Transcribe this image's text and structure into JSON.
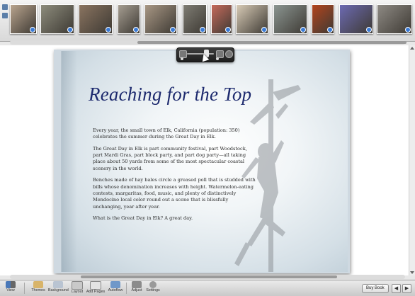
{
  "filmstrip": {
    "photos": [
      {
        "name": "group-snapshot",
        "color": "#b9a48e"
      },
      {
        "name": "outdoor-group",
        "color": "#8d8c7c"
      },
      {
        "name": "kids-pony",
        "color": "#8a7460"
      },
      {
        "name": "dog",
        "color": "#a59d91"
      },
      {
        "name": "cowboy-hat-man",
        "color": "#a89784"
      },
      {
        "name": "man-standing",
        "color": "#7e7c73"
      },
      {
        "name": "girl-watermelon",
        "color": "#c66a5b"
      },
      {
        "name": "plate-of-food",
        "color": "#d8cbb6"
      },
      {
        "name": "coastline",
        "color": "#8b9591"
      },
      {
        "name": "poppies",
        "color": "#b2441c"
      },
      {
        "name": "purple-flowers",
        "color": "#6c6ab2"
      },
      {
        "name": "peace-sign",
        "color": "#8e8a84"
      }
    ]
  },
  "page": {
    "title": "Reaching for the Top",
    "paragraphs": [
      "Every year, the small town of Elk, California (population: 350) celebrates the summer during the Great Day in Elk.",
      "The Great Day in Elk is part community festival, part Woodstock, part Mardi Gras, part block party, and part dog party—all taking place about 50 yards from some of the most spectacular coastal scenery in the world.",
      "Benches made of hay bales circle a greased poll that is studded with bills whose denomination increases with height. Watermelon-eating contests, margaritas, food, music, and plenty of distinctively Mendocino local color round out a scene that is blissfully unchanging, year after year.",
      "What is the Great Day in Elk? A great day."
    ]
  },
  "toolbar": {
    "view": "View",
    "themes": "Themes",
    "background": "Background",
    "layout": "Layout",
    "add_pages": "Add Pages",
    "autoflow": "Autoflow",
    "adjust": "Adjust",
    "settings": "Settings",
    "buy_book": "Buy Book",
    "prev": "◀",
    "next": "▶"
  },
  "colors": {
    "title": "#1d2a6e",
    "accent": "#3b7bd6"
  }
}
